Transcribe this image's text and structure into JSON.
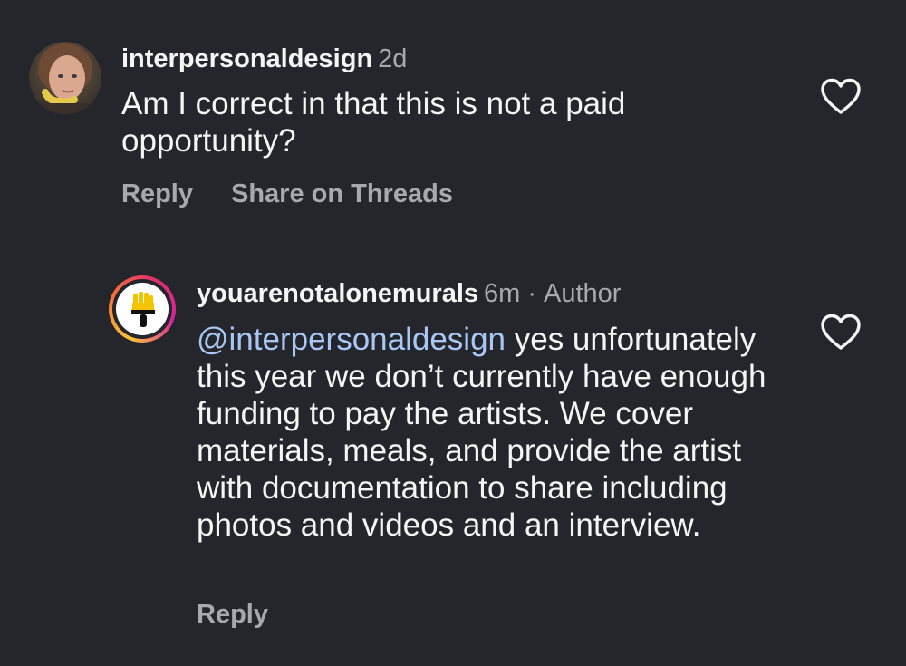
{
  "comments": [
    {
      "username": "interpersonaldesign",
      "time": "2d",
      "text": "Am I correct in that this is not a paid opportunity?",
      "actions": [
        "Reply",
        "Share on Threads"
      ],
      "like_icon": "heart-outline-icon"
    },
    {
      "username": "youarenotalonemurals",
      "time": "6m",
      "separator": "·",
      "badge": "Author",
      "mention": "@interpersonaldesign",
      "text": " yes unfortunately this year we don’t currently have enough funding to pay the artists. We cover materials, meals, and provide the artist with documentation to share including photos and videos and an interview.",
      "actions": [
        "Reply"
      ],
      "like_icon": "heart-outline-icon",
      "avatar_icon": "paintbrush-hand-icon"
    }
  ],
  "colors": {
    "background": "#25262b",
    "text": "#f5f5f5",
    "muted": "#a8a9ad",
    "mention": "#a8c7f5",
    "story_ring_start": "#fdc33a",
    "story_ring_end": "#d6249f"
  }
}
